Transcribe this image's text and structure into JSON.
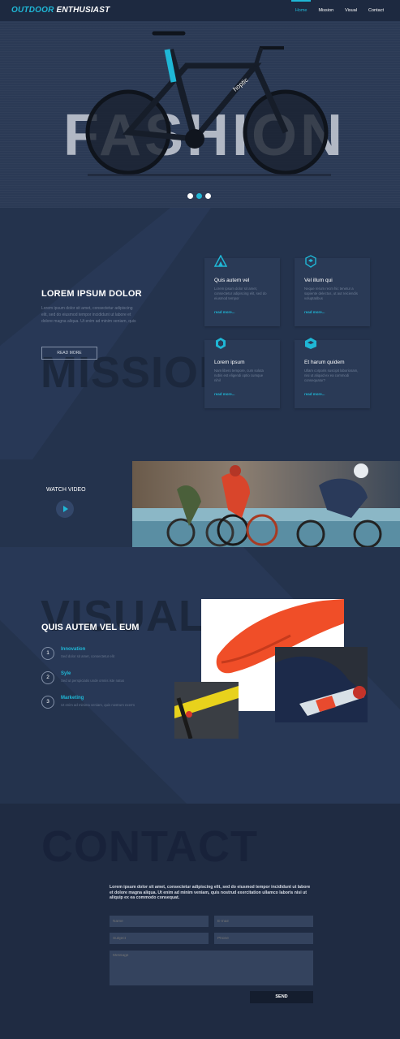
{
  "nav": {
    "logo_part1": "OUTDOOR",
    "logo_part2": "ENTHUSIAST",
    "links": [
      "Home",
      "Mission",
      "Visual",
      "Contact"
    ],
    "active": "Home"
  },
  "hero": {
    "background_word": "FASHION",
    "bike_brand": "hoptic",
    "slides": 3,
    "active_slide": 2
  },
  "mission": {
    "background_word": "MISSION",
    "title": "LOREM IPSUM DOLOR",
    "text": "Lorem ipsum dolor sit amet, consectetur adipiscing elit, sed do eiusmod tempor incididunt ut labore et dolore magna aliqua. Ut enim ad minim veniam, quis",
    "button": "READ MORE",
    "cards": [
      {
        "icon": "triangles-icon",
        "title": "Quis autem vel",
        "text": "Lorem ipsum dolor sit amet, consectetur adipiscing elit, sed do eiusmod tempor",
        "link": "read more..."
      },
      {
        "icon": "cubes-icon",
        "title": "Vel illum qui",
        "text": "Neque rerum recm hic tenetur a sapiente delectus, ut aut reiciendis voluptatibus",
        "link": "read more..."
      },
      {
        "icon": "hexagon-icon",
        "title": "Lorem ipsum",
        "text": "Nam libero tempore, cum soluta nobis est eligendi optio cumque nihil",
        "link": "read more..."
      },
      {
        "icon": "box-icon",
        "title": "Et harum quidem",
        "text": "Ullam corporis suscipit laboriosam, nisi ut aliquid ex ea commodi consequatur?",
        "link": "read more..."
      }
    ]
  },
  "video": {
    "label": "WATCH VIDEO"
  },
  "visual": {
    "background_word": "VISUAL",
    "title": "QUIS AUTEM VEL EUM",
    "steps": [
      {
        "num": "1",
        "title": "Innovation",
        "text": "Sed dolor sit amet, consectetur elit"
      },
      {
        "num": "2",
        "title": "Syle",
        "text": "Sed ut perspiciatis unde omnis iste natus"
      },
      {
        "num": "3",
        "title": "Marketing",
        "text": "Ut enim ad minima veniam, quis nostrum exerm"
      }
    ]
  },
  "contact": {
    "background_word": "CONTACT",
    "text": "Lorem ipsum dolor sit amet, consectetur adipiscing elit, sed do eiusmod tempor incididunt ut labore et dolore magna aliqua. Ut enim ad minim veniam, quis nostrud exercitation ullamco laboris nisi ut aliquip ex ea commodo consequat.",
    "fields": {
      "name": "Name",
      "email": "E-mail",
      "subject": "Subject",
      "phone": "Phone",
      "message": "Message"
    },
    "send": "SEND"
  },
  "colors": {
    "accent": "#1fb7d6",
    "nav_bg": "#1d2940",
    "section_bg": "#24334d",
    "card_bg": "#2a3a56",
    "contact_bg": "#1f2b42"
  }
}
